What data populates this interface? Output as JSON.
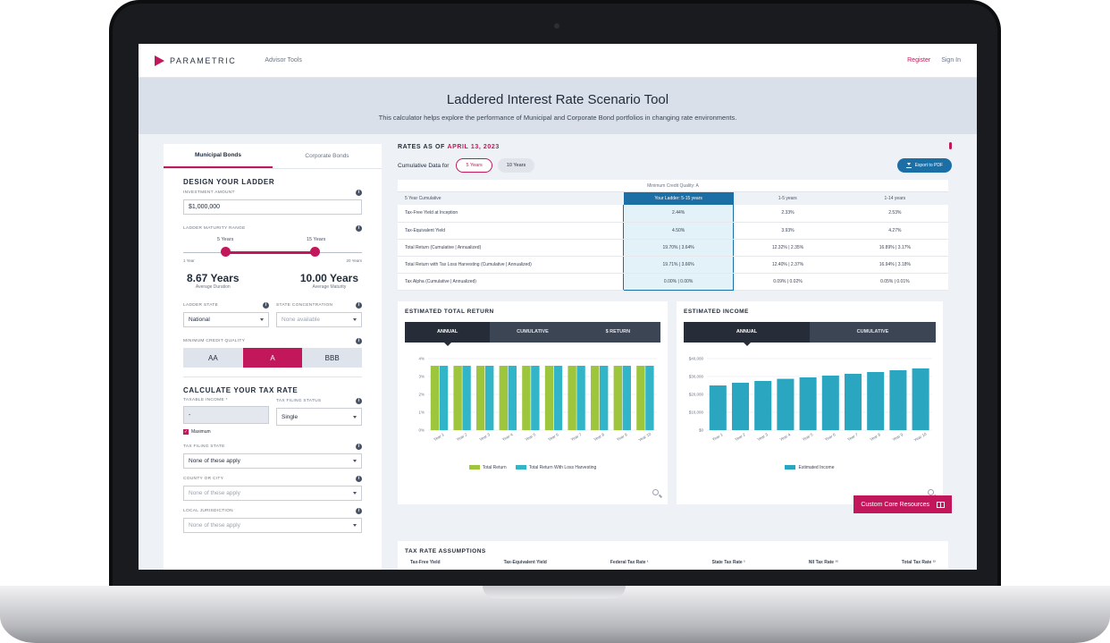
{
  "nav": {
    "brand": "PARAMETRIC",
    "link": "Advisor Tools",
    "register": "Register",
    "sign_in": "Sign In"
  },
  "hero": {
    "title": "Laddered Interest Rate Scenario Tool",
    "subtitle": "This calculator helps explore the performance of Municipal and Corporate Bond portfolios in changing rate environments."
  },
  "left": {
    "tabs": [
      "Municipal Bonds",
      "Corporate Bonds"
    ],
    "design_title": "DESIGN YOUR LADDER",
    "investment_label": "INVESTMENT AMOUNT",
    "investment_value": "$1,000,000",
    "range_label": "LADDER MATURITY RANGE",
    "range_low": "5 Years",
    "range_high": "15 Years",
    "range_min": "1 Year",
    "range_max": "20 Years",
    "range_low_value": 5,
    "range_high_value": 15,
    "avg_duration": "8.67 Years",
    "avg_duration_cap": "Average Duration",
    "avg_maturity": "10.00 Years",
    "avg_maturity_cap": "Average Maturity",
    "state_label": "LADDER STATE",
    "state_value": "National",
    "conc_label": "STATE CONCENTRATION",
    "conc_value": "None available",
    "credit_label": "MINIMUM CREDIT QUALITY",
    "credit_options": [
      "AA",
      "A",
      "BBB"
    ],
    "credit_selected": "A",
    "tax_title": "CALCULATE YOUR TAX RATE",
    "income_label": "TAXABLE INCOME *",
    "income_value": "-",
    "filing_label": "TAX FILING STATUS",
    "filing_value": "Single",
    "maximum_label": "Maximum",
    "filing_state_label": "TAX FILING STATE",
    "filing_state_value": "None of these apply",
    "county_label": "COUNTY OR CITY",
    "county_value": "None of these apply",
    "local_label": "LOCAL JURISDICTION",
    "local_value": "None of these apply"
  },
  "rates": {
    "title_prefix": "RATES AS OF ",
    "date": "APRIL 13, 2023",
    "cum_label": "Cumulative Data for",
    "pill_5": "5 Years",
    "pill_10": "10 Years",
    "export": "Export to PDF"
  },
  "table": {
    "head": "Minimum Credit Quality: A",
    "columns": [
      "5 Year Cumulative",
      "Your Ladder: 5-15 years",
      "1-5 years",
      "1-14 years"
    ],
    "rows": [
      [
        "Tax-Free Yield at Inception",
        "2.44%",
        "2.33%",
        "2.53%"
      ],
      [
        "Tax-Equivalent Yield",
        "4.50%",
        "3.93%",
        "4.27%"
      ],
      [
        "Total Return (Cumulative | Annualized)",
        "19.70% | 3.64%",
        "12.32% | 2.35%",
        "16.89% | 3.17%"
      ],
      [
        "Total Return with Tax Loss Harvesting (Cumulative | Annualized)",
        "19.71% | 3.66%",
        "12.40% | 2.37%",
        "16.94% | 3.18%"
      ],
      [
        "Tax Alpha (Cumulative | Annualized)",
        "0.00% | 0.00%",
        "0.09% | 0.02%",
        "0.05% | 0.01%"
      ]
    ]
  },
  "chart_return": {
    "title": "ESTIMATED TOTAL RETURN",
    "tabs": [
      "ANNUAL",
      "CUMULATIVE",
      "$ RETURN"
    ],
    "legend": [
      "Total Return",
      "Total Return With Loss Harvesting"
    ]
  },
  "chart_income": {
    "title": "ESTIMATED INCOME",
    "tabs": [
      "ANNUAL",
      "CUMULATIVE"
    ],
    "legend": [
      "Estimated Income"
    ]
  },
  "chart_data": [
    {
      "type": "bar",
      "title": "ESTIMATED TOTAL RETURN",
      "categories": [
        "Year 1",
        "Year 2",
        "Year 3",
        "Year 4",
        "Year 5",
        "Year 6",
        "Year 7",
        "Year 8",
        "Year 9",
        "Year 10"
      ],
      "series": [
        {
          "name": "Total Return",
          "values": [
            3.6,
            3.6,
            3.6,
            3.6,
            3.6,
            3.6,
            3.6,
            3.6,
            3.6,
            3.6
          ]
        },
        {
          "name": "Total Return With Loss Harvesting",
          "values": [
            3.6,
            3.6,
            3.6,
            3.6,
            3.6,
            3.6,
            3.6,
            3.6,
            3.6,
            3.6
          ]
        }
      ],
      "yticks": [
        "0%",
        "1%",
        "2%",
        "3%",
        "4%"
      ],
      "ylim": [
        0,
        4
      ],
      "colors": [
        "#9dc63c",
        "#32b5c8"
      ]
    },
    {
      "type": "bar",
      "title": "ESTIMATED INCOME",
      "categories": [
        "Year 1",
        "Year 2",
        "Year 3",
        "Year 4",
        "Year 5",
        "Year 6",
        "Year 7",
        "Year 8",
        "Year 9",
        "Year 10"
      ],
      "series": [
        {
          "name": "Estimated Income",
          "values": [
            25000,
            26500,
            27500,
            28700,
            29500,
            30500,
            31500,
            32500,
            33500,
            34500
          ]
        }
      ],
      "yticks": [
        "$0",
        "$10,000",
        "$20,000",
        "$30,000",
        "$40,000"
      ],
      "ylim": [
        0,
        40000
      ],
      "colors": [
        "#2aa6c1"
      ]
    }
  ],
  "tax": {
    "title": "TAX RATE ASSUMPTIONS",
    "columns": [
      "Tax-Free Yield",
      "Tax-Equivalent Yield",
      "Federal Tax Rate ¹",
      "State Tax Rate ¹",
      "NII Tax Rate ¹²",
      "Total Tax Rate ¹²"
    ]
  },
  "resources": "Custom Core Resources"
}
